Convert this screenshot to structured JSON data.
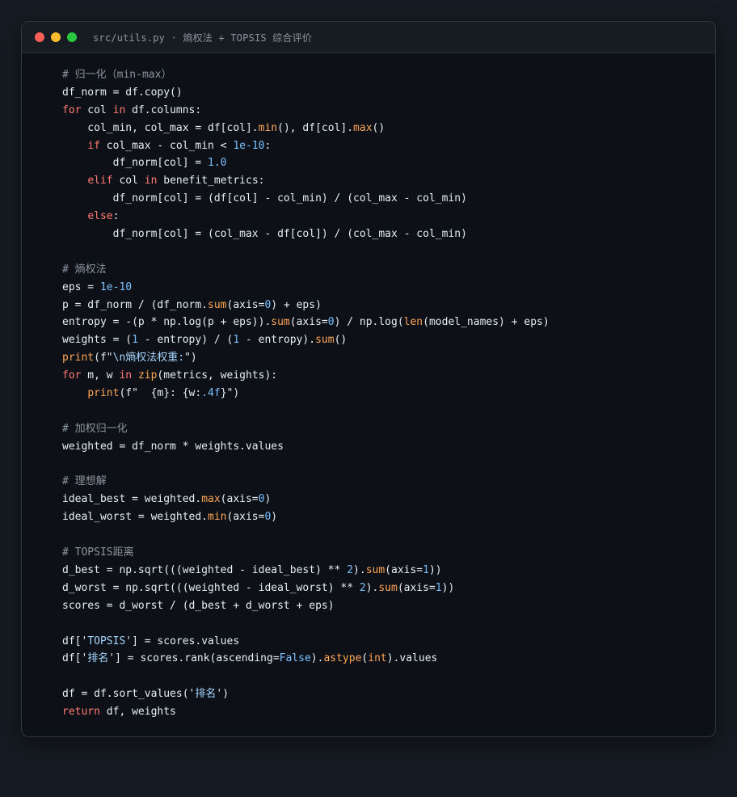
{
  "window": {
    "title": "src/utils.py · 熵权法 + TOPSIS 综合评价",
    "controls": [
      "close",
      "minimize",
      "maximize"
    ]
  },
  "colors": {
    "keyword": "#ff7b72",
    "function": "#ffa657",
    "number": "#79c0ff",
    "string": "#a5d6ff",
    "comment": "#8b949e",
    "text": "#e6edf3",
    "background": "#0d1117"
  },
  "code": {
    "language": "python",
    "lines": [
      [
        {
          "t": "cm",
          "v": "# 归一化（min-max）"
        }
      ],
      [
        {
          "t": "tx",
          "v": "df_norm = df.copy()"
        }
      ],
      [
        {
          "t": "kw",
          "v": "for"
        },
        {
          "t": "tx",
          "v": " col "
        },
        {
          "t": "kw",
          "v": "in"
        },
        {
          "t": "tx",
          "v": " df.columns:"
        }
      ],
      [
        {
          "t": "tx",
          "v": "    col_min, col_max = df[col]."
        },
        {
          "t": "fn",
          "v": "min"
        },
        {
          "t": "tx",
          "v": "(), df[col]."
        },
        {
          "t": "fn",
          "v": "max"
        },
        {
          "t": "tx",
          "v": "()"
        }
      ],
      [
        {
          "t": "tx",
          "v": "    "
        },
        {
          "t": "kw",
          "v": "if"
        },
        {
          "t": "tx",
          "v": " col_max - col_min < "
        },
        {
          "t": "num",
          "v": "1e-10"
        },
        {
          "t": "tx",
          "v": ":"
        }
      ],
      [
        {
          "t": "tx",
          "v": "        df_norm[col] = "
        },
        {
          "t": "num",
          "v": "1.0"
        }
      ],
      [
        {
          "t": "tx",
          "v": "    "
        },
        {
          "t": "kw",
          "v": "elif"
        },
        {
          "t": "tx",
          "v": " col "
        },
        {
          "t": "kw",
          "v": "in"
        },
        {
          "t": "tx",
          "v": " benefit_metrics:"
        }
      ],
      [
        {
          "t": "tx",
          "v": "        df_norm[col] = (df[col] - col_min) / (col_max - col_min)"
        }
      ],
      [
        {
          "t": "tx",
          "v": "    "
        },
        {
          "t": "kw",
          "v": "else"
        },
        {
          "t": "tx",
          "v": ":"
        }
      ],
      [
        {
          "t": "tx",
          "v": "        df_norm[col] = (col_max - df[col]) / (col_max - col_min)"
        }
      ],
      [],
      [
        {
          "t": "cm",
          "v": "# 熵权法"
        }
      ],
      [
        {
          "t": "tx",
          "v": "eps = "
        },
        {
          "t": "num",
          "v": "1e-10"
        }
      ],
      [
        {
          "t": "tx",
          "v": "p = df_norm / (df_norm."
        },
        {
          "t": "fn",
          "v": "sum"
        },
        {
          "t": "tx",
          "v": "(axis="
        },
        {
          "t": "num",
          "v": "0"
        },
        {
          "t": "tx",
          "v": ") + eps)"
        }
      ],
      [
        {
          "t": "tx",
          "v": "entropy = -(p * np.log(p + eps))."
        },
        {
          "t": "fn",
          "v": "sum"
        },
        {
          "t": "tx",
          "v": "(axis="
        },
        {
          "t": "num",
          "v": "0"
        },
        {
          "t": "tx",
          "v": ") / np.log("
        },
        {
          "t": "fn",
          "v": "len"
        },
        {
          "t": "tx",
          "v": "(model_names) + eps)"
        }
      ],
      [
        {
          "t": "tx",
          "v": "weights = ("
        },
        {
          "t": "num",
          "v": "1"
        },
        {
          "t": "tx",
          "v": " - entropy) / ("
        },
        {
          "t": "num",
          "v": "1"
        },
        {
          "t": "tx",
          "v": " - entropy)."
        },
        {
          "t": "fn",
          "v": "sum"
        },
        {
          "t": "tx",
          "v": "()"
        }
      ],
      [
        {
          "t": "fn",
          "v": "print"
        },
        {
          "t": "tx",
          "v": "(f\""
        },
        {
          "t": "str",
          "v": "\\n熵权法权重:"
        },
        {
          "t": "tx",
          "v": "\")"
        }
      ],
      [
        {
          "t": "kw",
          "v": "for"
        },
        {
          "t": "tx",
          "v": " m, w "
        },
        {
          "t": "kw",
          "v": "in"
        },
        {
          "t": "tx",
          "v": " "
        },
        {
          "t": "fn",
          "v": "zip"
        },
        {
          "t": "tx",
          "v": "(metrics, weights):"
        }
      ],
      [
        {
          "t": "tx",
          "v": "    "
        },
        {
          "t": "fn",
          "v": "print"
        },
        {
          "t": "tx",
          "v": "(f\"  {m}: {w:"
        },
        {
          "t": "num",
          "v": ".4f"
        },
        {
          "t": "tx",
          "v": "}\")"
        }
      ],
      [],
      [
        {
          "t": "cm",
          "v": "# 加权归一化"
        }
      ],
      [
        {
          "t": "tx",
          "v": "weighted = df_norm * weights.values"
        }
      ],
      [],
      [
        {
          "t": "cm",
          "v": "# 理想解"
        }
      ],
      [
        {
          "t": "tx",
          "v": "ideal_best = weighted."
        },
        {
          "t": "fn",
          "v": "max"
        },
        {
          "t": "tx",
          "v": "(axis="
        },
        {
          "t": "num",
          "v": "0"
        },
        {
          "t": "tx",
          "v": ")"
        }
      ],
      [
        {
          "t": "tx",
          "v": "ideal_worst = weighted."
        },
        {
          "t": "fn",
          "v": "min"
        },
        {
          "t": "tx",
          "v": "(axis="
        },
        {
          "t": "num",
          "v": "0"
        },
        {
          "t": "tx",
          "v": ")"
        }
      ],
      [],
      [
        {
          "t": "cm",
          "v": "# TOPSIS距离"
        }
      ],
      [
        {
          "t": "tx",
          "v": "d_best = np.sqrt(((weighted - ideal_best) ** "
        },
        {
          "t": "num",
          "v": "2"
        },
        {
          "t": "tx",
          "v": ")."
        },
        {
          "t": "fn",
          "v": "sum"
        },
        {
          "t": "tx",
          "v": "(axis="
        },
        {
          "t": "num",
          "v": "1"
        },
        {
          "t": "tx",
          "v": "))"
        }
      ],
      [
        {
          "t": "tx",
          "v": "d_worst = np.sqrt(((weighted - ideal_worst) ** "
        },
        {
          "t": "num",
          "v": "2"
        },
        {
          "t": "tx",
          "v": ")."
        },
        {
          "t": "fn",
          "v": "sum"
        },
        {
          "t": "tx",
          "v": "(axis="
        },
        {
          "t": "num",
          "v": "1"
        },
        {
          "t": "tx",
          "v": "))"
        }
      ],
      [
        {
          "t": "tx",
          "v": "scores = d_worst / (d_best + d_worst + eps)"
        }
      ],
      [],
      [
        {
          "t": "tx",
          "v": "df['"
        },
        {
          "t": "str",
          "v": "TOPSIS"
        },
        {
          "t": "tx",
          "v": "'] = scores.values"
        }
      ],
      [
        {
          "t": "tx",
          "v": "df['"
        },
        {
          "t": "str",
          "v": "排名"
        },
        {
          "t": "tx",
          "v": "'] = scores.rank(ascending="
        },
        {
          "t": "num",
          "v": "False"
        },
        {
          "t": "tx",
          "v": ")."
        },
        {
          "t": "fn",
          "v": "astype"
        },
        {
          "t": "tx",
          "v": "("
        },
        {
          "t": "fn",
          "v": "int"
        },
        {
          "t": "tx",
          "v": ").values"
        }
      ],
      [],
      [
        {
          "t": "tx",
          "v": "df = df.sort_values('"
        },
        {
          "t": "str",
          "v": "排名"
        },
        {
          "t": "tx",
          "v": "')"
        }
      ],
      [
        {
          "t": "kw",
          "v": "return"
        },
        {
          "t": "tx",
          "v": " df, weights"
        }
      ]
    ]
  }
}
